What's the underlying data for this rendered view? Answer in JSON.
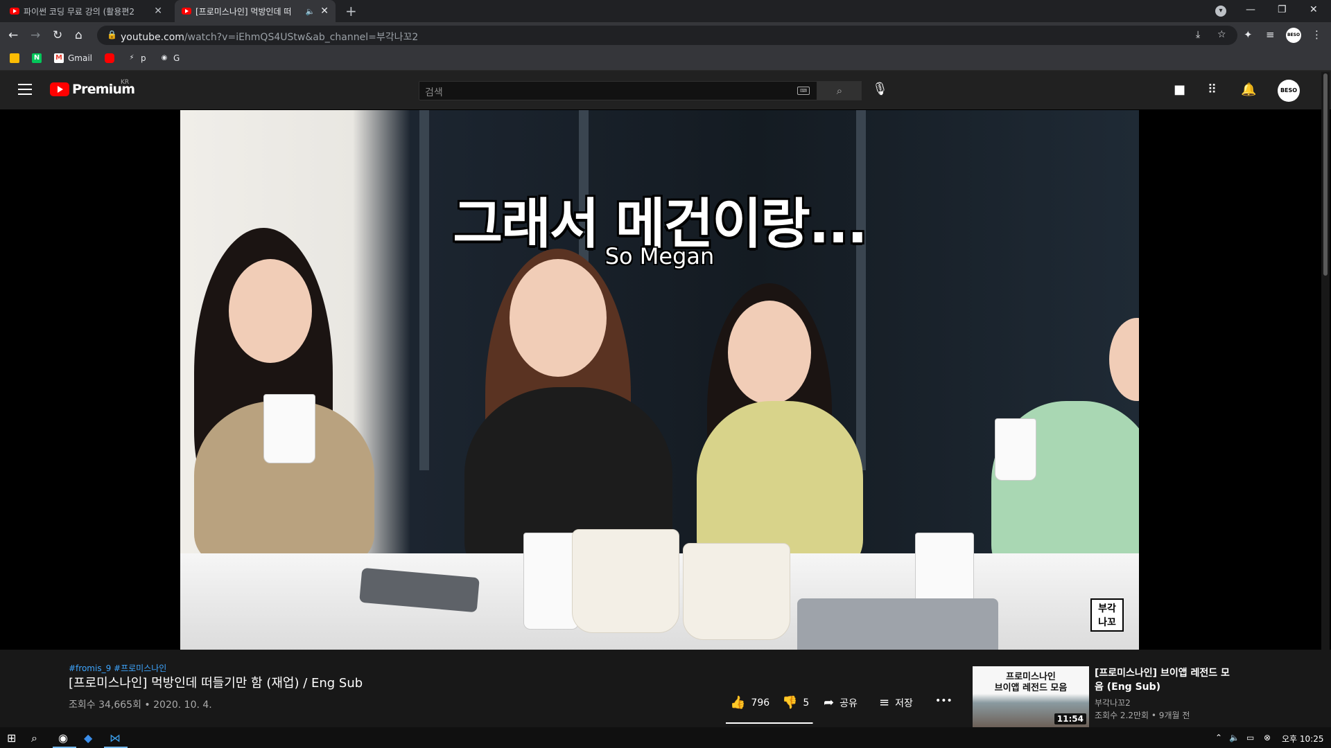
{
  "browser": {
    "tabs": [
      {
        "title": "파이썬 코딩 무료 강의 (활용편2",
        "close": "✕"
      },
      {
        "title": "[프로미스나인] 먹방인데 떠",
        "speaker": "🔈",
        "close": "✕"
      }
    ],
    "new_tab": "+",
    "window": {
      "minimize": "—",
      "restore": "❐",
      "close": "✕"
    },
    "nav": {
      "back": "←",
      "forward": "→",
      "reload": "↻",
      "home": "⌂"
    },
    "url": {
      "host": "youtube.com",
      "path": "/watch?v=iEhmQS4UStw&ab_channel=부각나꼬2"
    },
    "bookmarks": [
      {
        "label": "",
        "icon": "folder-icon",
        "color": "#fbbc04"
      },
      {
        "label": "",
        "icon": "naver-icon",
        "glyph": "N",
        "color": "#03c75a"
      },
      {
        "label": "Gmail",
        "icon": "gmail-icon",
        "glyph": "M",
        "color": "#ea4335"
      },
      {
        "label": "",
        "icon": "youtube-icon",
        "color": "#ff0000"
      },
      {
        "label": "p",
        "icon": "bolt-icon",
        "glyph": "⚡",
        "color": "#35363a"
      },
      {
        "label": "G",
        "icon": "github-icon",
        "glyph": "◉",
        "color": "#35363a"
      }
    ],
    "profile": "BESO"
  },
  "youtube": {
    "logo_text": "Premium",
    "logo_country": "KR",
    "search_placeholder": "검색",
    "avatar": "BESO"
  },
  "player": {
    "subtitle_ko": "그래서 메건이랑...",
    "subtitle_en": "So Megan",
    "watermark": "부각\n나꼬"
  },
  "video": {
    "hashtags": "#fromis_9 #프로미스나인",
    "title": "[프로미스나인] 먹방인데 떠들기만 함 (재업) / Eng Sub",
    "views": "조회수 34,665회",
    "date": "2020. 10. 4.",
    "likes": "796",
    "dislikes": "5",
    "like_ratio": 0.99,
    "share": "공유",
    "save": "저장",
    "more": "•••"
  },
  "recommendation": {
    "thumb_text": "프로미스나인\n브이앱 레전드 모음",
    "duration": "11:54",
    "title": "[프로미스나인] 브이앱 레전드 모음 (Eng Sub)",
    "channel": "부각나꼬2",
    "meta": "조회수 2.2만회 • 9개월 전"
  },
  "taskbar": {
    "clock": "오후 10:25"
  },
  "colors": {
    "yt_red": "#ff0000",
    "link_blue": "#3ea6ff",
    "bg_dark": "#181818"
  }
}
